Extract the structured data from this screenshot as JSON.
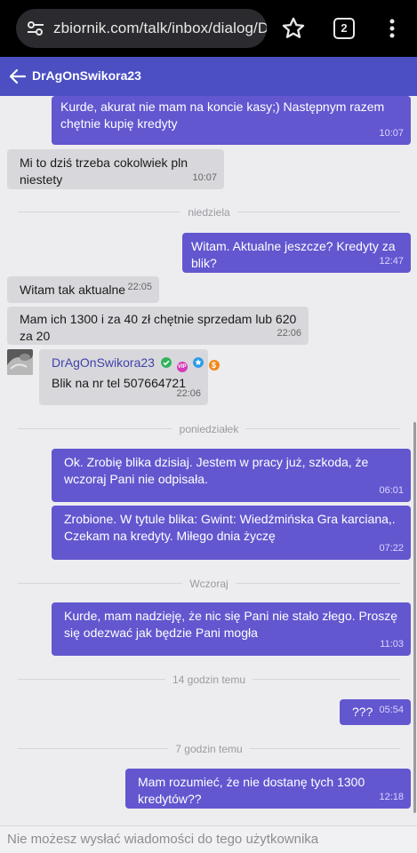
{
  "browser": {
    "url": "zbiornik.com/talk/inbox/dialog/DrAg",
    "tab_count": "2"
  },
  "header": {
    "title": "DrAgOnSwikora23"
  },
  "separators": {
    "niedziela": "niedziela",
    "poniedzialek": "poniedziałek",
    "wczoraj": "Wczoraj",
    "h14": "14 godzin temu",
    "h7": "7 godzin temu"
  },
  "messages": {
    "m1": {
      "text": "Kurde, akurat nie mam na koncie kasy;) Następnym razem chętnie kupię kredyty",
      "time": "10:07"
    },
    "m2": {
      "text": "Mi to dziś trzeba cokolwiek pln niestety",
      "time": "10:07"
    },
    "m3": {
      "text": "Witam. Aktualne jeszcze? Kredyty za blik?",
      "time": "12:47"
    },
    "m4": {
      "text": "Witam tak aktualne",
      "time": "22:05"
    },
    "m5": {
      "text": "Mam ich 1300 i za 40 zł chętnie sprzedam lub 620 za 20",
      "time": "22:06"
    },
    "m6": {
      "sender": "DrAgOnSwikora23",
      "text": "Blik na nr tel 507664721",
      "time": "22:06",
      "badge_vip": "VIP",
      "badge_coin": "$"
    },
    "m7": {
      "text": "Ok. Zrobię blika dzisiaj. Jestem w pracy już, szkoda, że wczoraj Pani nie odpisała.",
      "time": "06:01"
    },
    "m8": {
      "text": "Zrobione. W tytule blika: Gwint: Wiedźmińska Gra karciana,. Czekam na kredyty. Miłego dnia życzę",
      "time": "07:22"
    },
    "m9": {
      "text": "Kurde, mam nadzieję, że nic się Pani nie stało złego. Proszę się odezwać jak będzie Pani mogła",
      "time": "11:03"
    },
    "m10": {
      "text": "???",
      "time": "05:54"
    },
    "m11": {
      "text": "Mam rozumieć, że nie dostanę tych 1300 kredytów??",
      "time": "12:18"
    }
  },
  "footer": {
    "notice": "Nie możesz wysłać wiadomości do tego użytkownika"
  },
  "colors": {
    "header_bg": "#4b4fc2",
    "outgoing_bubble": "#6257cf",
    "incoming_bubble": "#d8d8dc",
    "badge_verified": "#2fb35a",
    "badge_vip": "#d63cb7",
    "badge_star": "#2a9be8",
    "badge_coin": "#f08a1c"
  },
  "icons": [
    "tune-icon",
    "star-outline-icon",
    "tab-counter-icon",
    "more-vert-icon",
    "back-arrow-icon",
    "verified-check-icon",
    "vip-badge-icon",
    "star-badge-icon",
    "coin-badge-icon"
  ]
}
